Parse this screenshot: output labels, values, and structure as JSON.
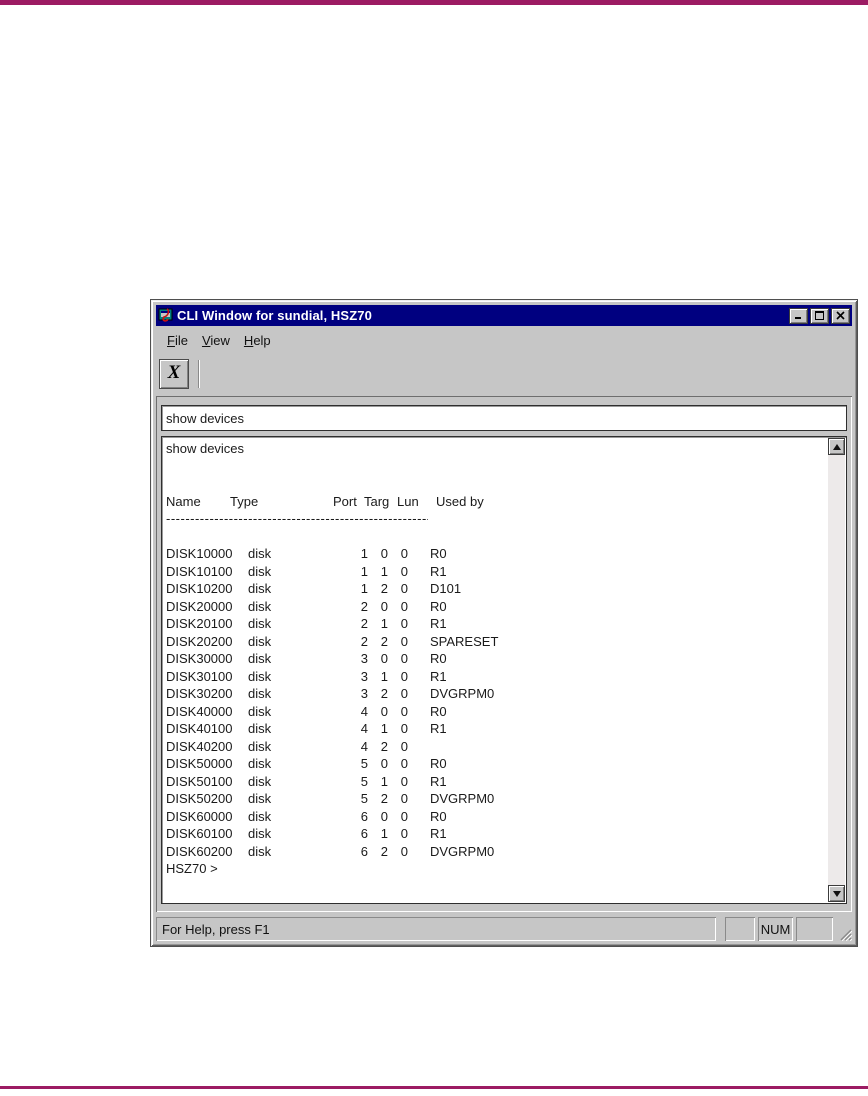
{
  "page": {
    "top_rule_color": "#9C1B63",
    "bottom_rule_color": "#9C1B63"
  },
  "window": {
    "title": "CLI Window for sundial, HSZ70",
    "titlebar_color": "#000080",
    "menubar": {
      "items": [
        {
          "label": "File"
        },
        {
          "label": "View"
        },
        {
          "label": "Help"
        }
      ]
    },
    "toolbar": {
      "exit_button_glyph": "X"
    },
    "command_input": {
      "value": "show devices"
    },
    "terminal": {
      "echoed_command": "show devices",
      "table": {
        "columns": [
          "Name",
          "Type",
          "Port",
          "Targ",
          "Lun",
          "Used by"
        ],
        "separator": "------------------------------------------------------------------------------",
        "rows": [
          {
            "name": "DISK10000",
            "type": "disk",
            "port": "1",
            "targ": "0",
            "lun": "0",
            "used_by": "R0"
          },
          {
            "name": "DISK10100",
            "type": "disk",
            "port": "1",
            "targ": "1",
            "lun": "0",
            "used_by": "R1"
          },
          {
            "name": "DISK10200",
            "type": "disk",
            "port": "1",
            "targ": "2",
            "lun": "0",
            "used_by": "D101"
          },
          {
            "name": "DISK20000",
            "type": "disk",
            "port": "2",
            "targ": "0",
            "lun": "0",
            "used_by": "R0"
          },
          {
            "name": "DISK20100",
            "type": "disk",
            "port": "2",
            "targ": "1",
            "lun": "0",
            "used_by": "R1"
          },
          {
            "name": "DISK20200",
            "type": "disk",
            "port": "2",
            "targ": "2",
            "lun": "0",
            "used_by": "SPARESET"
          },
          {
            "name": "DISK30000",
            "type": "disk",
            "port": "3",
            "targ": "0",
            "lun": "0",
            "used_by": "R0"
          },
          {
            "name": "DISK30100",
            "type": "disk",
            "port": "3",
            "targ": "1",
            "lun": "0",
            "used_by": "R1"
          },
          {
            "name": "DISK30200",
            "type": "disk",
            "port": "3",
            "targ": "2",
            "lun": "0",
            "used_by": "DVGRPM0"
          },
          {
            "name": "DISK40000",
            "type": "disk",
            "port": "4",
            "targ": "0",
            "lun": "0",
            "used_by": "R0"
          },
          {
            "name": "DISK40100",
            "type": "disk",
            "port": "4",
            "targ": "1",
            "lun": "0",
            "used_by": "R1"
          },
          {
            "name": "DISK40200",
            "type": "disk",
            "port": "4",
            "targ": "2",
            "lun": "0",
            "used_by": ""
          },
          {
            "name": "DISK50000",
            "type": "disk",
            "port": "5",
            "targ": "0",
            "lun": "0",
            "used_by": "R0"
          },
          {
            "name": "DISK50100",
            "type": "disk",
            "port": "5",
            "targ": "1",
            "lun": "0",
            "used_by": "R1"
          },
          {
            "name": "DISK50200",
            "type": "disk",
            "port": "5",
            "targ": "2",
            "lun": "0",
            "used_by": "DVGRPM0"
          },
          {
            "name": "DISK60000",
            "type": "disk",
            "port": "6",
            "targ": "0",
            "lun": "0",
            "used_by": "R0"
          },
          {
            "name": "DISK60100",
            "type": "disk",
            "port": "6",
            "targ": "1",
            "lun": "0",
            "used_by": "R1"
          },
          {
            "name": "DISK60200",
            "type": "disk",
            "port": "6",
            "targ": "2",
            "lun": "0",
            "used_by": "DVGRPM0"
          }
        ]
      },
      "prompt": "HSZ70 >"
    },
    "statusbar": {
      "message": "For Help, press F1",
      "indicators": [
        "",
        "NUM",
        ""
      ]
    }
  }
}
